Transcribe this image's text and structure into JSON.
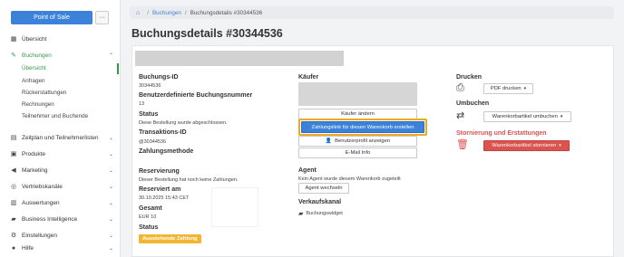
{
  "sidebar": {
    "pos_button": "Point of Sale",
    "more_button": "···",
    "items": [
      {
        "label": "Übersicht",
        "icon": "grid-icon"
      },
      {
        "label": "Buchungen",
        "icon": "ticket-icon"
      },
      {
        "label": "Zeitplan und Teilnehmerlisten",
        "icon": "calendar-icon"
      },
      {
        "label": "Produkte",
        "icon": "box-icon"
      },
      {
        "label": "Marketing",
        "icon": "megaphone-icon"
      },
      {
        "label": "Vertriebskanäle",
        "icon": "channel-icon"
      },
      {
        "label": "Auswertungen",
        "icon": "chart-icon"
      },
      {
        "label": "Business Intelligence",
        "icon": "bi-icon"
      },
      {
        "label": "Einstellungen",
        "icon": "gear-icon"
      },
      {
        "label": "Hilfe",
        "icon": "help-icon"
      }
    ],
    "subitems": [
      "Übersicht",
      "Anfragen",
      "Rückerstattungen",
      "Rechnungen",
      "Teilnehmer und Buchende"
    ]
  },
  "breadcrumb": {
    "link": "Buchungen",
    "sep": "/",
    "current": "Buchungsdetails #30344536"
  },
  "page_title": "Buchungsdetails #30344536",
  "details": {
    "booking_id_label": "Buchungs-ID",
    "booking_id": "30344536",
    "custom_number_label": "Benutzerdefinierte Buchungsnummer",
    "custom_number": "13",
    "status_label": "Status",
    "status_text": "Diese Bestellung wurde abgeschlossen.",
    "transaction_label": "Transaktions-ID",
    "transaction_id": "@30344536",
    "payment_method_label": "Zahlungsmethode",
    "reservation_label": "Reservierung",
    "reservation_text": "Dieser Bestellung hat noch keine Zahlungen.",
    "reserved_on_label": "Reserviert am",
    "reserved_on": "30.10.2025 15:43 CET",
    "total_label": "Gesamt",
    "total": "EUR 10",
    "status2_label": "Status",
    "status2_badge": "Ausstehende Zahlung"
  },
  "buyer": {
    "label": "Käufer",
    "change_buyer": "Käufer ändern",
    "payment_link": "Zahlungslink für diesen Warenkorb erstellen",
    "user_profile": "Benutzerprofil anzeigen",
    "email_info": "E-Mail Info",
    "agent_label": "Agent",
    "agent_text": "Kein Agent wurde diesem Warenkorb zugeteilt",
    "change_agent": "Agent wechseln",
    "sales_channel_label": "Verkaufskanal",
    "sales_channel": "Buchungswidget"
  },
  "actions": {
    "print_label": "Drucken",
    "print_button": "PDF drucken",
    "rebook_label": "Umbuchen",
    "rebook_button": "Warenkorbartikel umbuchen",
    "cancel_label": "Stornierung und Erstattungen",
    "cancel_button": "Warenkorbartikel stornieren"
  },
  "colors": {
    "accent": "#3c82d8",
    "active_green": "#2f9b47",
    "danger": "#d9534f",
    "highlight": "#f0a81c",
    "badge": "#f2b632"
  }
}
